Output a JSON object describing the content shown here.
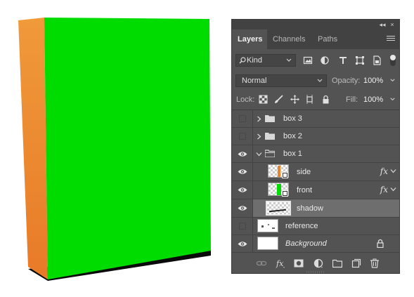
{
  "colors": {
    "box_front": "#00dc00",
    "box_side": "#ee8a30",
    "panel_bg": "#535353",
    "panel_dark": "#424242",
    "selected_row": "#6e6e6e"
  },
  "panel": {
    "tabs": [
      {
        "label": "Layers",
        "active": true
      },
      {
        "label": "Channels",
        "active": false
      },
      {
        "label": "Paths",
        "active": false
      }
    ],
    "filter": {
      "kind_label": "Kind",
      "icons": [
        "image-filter-icon",
        "adjustment-filter-icon",
        "type-filter-icon",
        "shape-filter-icon",
        "smart-object-filter-icon"
      ]
    },
    "blend": {
      "mode": "Normal",
      "opacity_label": "Opacity:",
      "opacity_value": "100%"
    },
    "lock": {
      "label": "Lock:",
      "fill_label": "Fill:",
      "fill_value": "100%"
    },
    "layers": [
      {
        "name": "box 3",
        "type": "group",
        "visible": false,
        "expanded": false
      },
      {
        "name": "box 2",
        "type": "group",
        "visible": false,
        "expanded": false
      },
      {
        "name": "box 1",
        "type": "group",
        "visible": true,
        "expanded": true
      },
      {
        "name": "side",
        "type": "smart-object",
        "visible": true,
        "fx": "fx"
      },
      {
        "name": "front",
        "type": "smart-object",
        "visible": true,
        "fx": "fx"
      },
      {
        "name": "shadow",
        "type": "layer",
        "visible": true,
        "selected": true
      },
      {
        "name": "reference",
        "type": "layer",
        "visible": false
      },
      {
        "name": "Background",
        "type": "background",
        "visible": true,
        "locked": true
      }
    ]
  }
}
